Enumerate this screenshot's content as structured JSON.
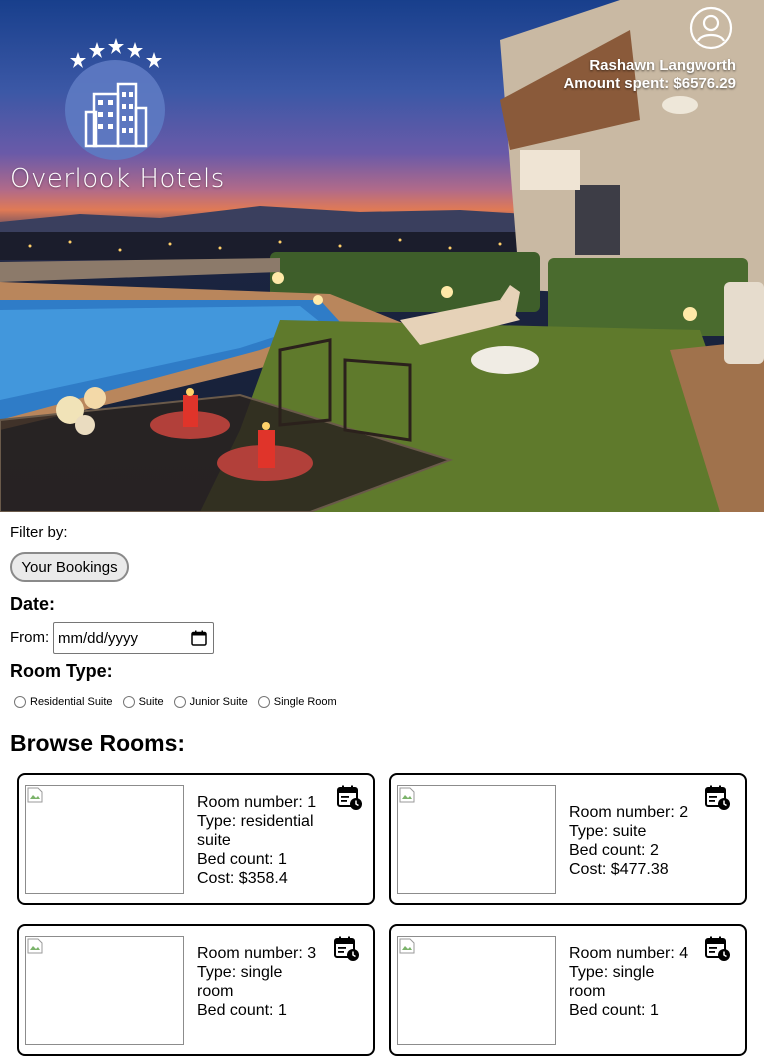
{
  "brand": {
    "name": "Overlook Hotels"
  },
  "user": {
    "name": "Rashawn Langworth",
    "amount_spent": "Amount spent: $6576.29",
    "icon": "user-circle-icon"
  },
  "filters": {
    "filter_by_label": "Filter by:",
    "bookings_button": "Your Bookings",
    "date_heading": "Date:",
    "from_label": "From:",
    "date_placeholder": "mm/dd/yyyy",
    "room_type_heading": "Room Type:",
    "room_types": [
      "Residential Suite",
      "Suite",
      "Junior Suite",
      "Single Room"
    ]
  },
  "browse_heading": "Browse Rooms:",
  "rooms": [
    {
      "number": "Room number: 1",
      "type": "Type: residential suite",
      "beds": "Bed count: 1",
      "cost": "Cost: $358.4"
    },
    {
      "number": "Room number: 2",
      "type": "Type: suite",
      "beds": "Bed count: 2",
      "cost": "Cost: $477.38"
    },
    {
      "number": "Room number: 3",
      "type": "Type: single room",
      "beds": "Bed count: 1",
      "cost": ""
    },
    {
      "number": "Room number: 4",
      "type": "Type: single room",
      "beds": "Bed count: 1",
      "cost": ""
    }
  ],
  "colors": {
    "border": "#000000",
    "button_bg": "#eaeaea"
  }
}
